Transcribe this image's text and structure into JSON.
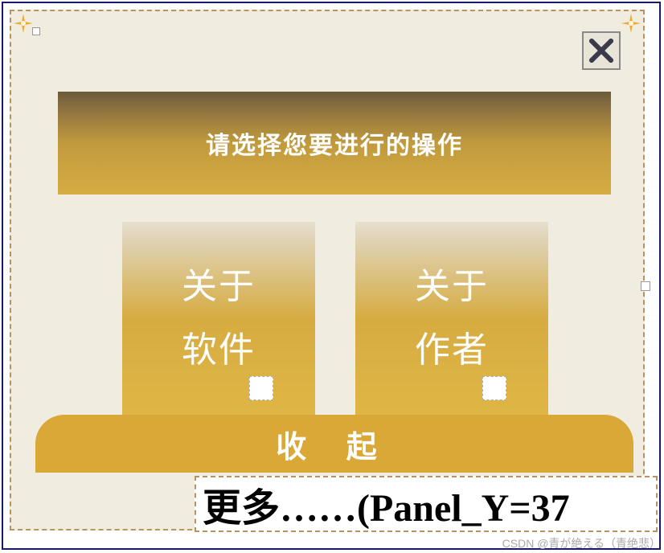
{
  "header": {
    "title": "请选择您要进行的操作"
  },
  "options": {
    "left": {
      "line1": "关于",
      "line2": "软件"
    },
    "right": {
      "line1": "关于",
      "line2": "作者"
    }
  },
  "collapse": {
    "label": "收 起"
  },
  "bottom": {
    "text": "更多……(Panel_Y=37"
  },
  "watermark": "CSDN @青が絶える（青绝悲）"
}
